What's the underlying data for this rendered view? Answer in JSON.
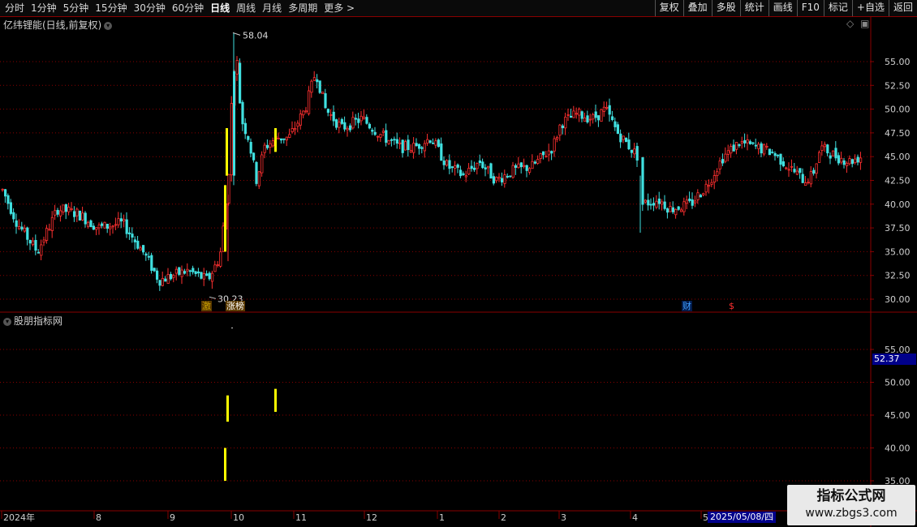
{
  "toolbar": {
    "periods": [
      "分时",
      "1分钟",
      "5分钟",
      "15分钟",
      "30分钟",
      "60分钟",
      "日线",
      "周线",
      "月线",
      "多周期",
      "更多 >"
    ],
    "active_period": "日线",
    "right_buttons": [
      "复权",
      "叠加",
      "多股",
      "统计",
      "画线",
      "F10",
      "标记",
      "+自选",
      "返回"
    ]
  },
  "main_panel": {
    "title": "亿纬锂能(日线,前复权)",
    "price_axis": [
      "55.00",
      "52.50",
      "50.00",
      "47.50",
      "45.00",
      "42.50",
      "40.00",
      "37.50",
      "35.00",
      "32.50",
      "30.00"
    ],
    "high_label": "58.04",
    "low_label": "30.23",
    "event_tags": [
      {
        "text": "激",
        "color": "#c8a000",
        "bg": "#5a3a00"
      },
      {
        "text": "涨榜",
        "color": "#ffffff",
        "bg": "#5a3a00"
      },
      {
        "text": "财",
        "color": "#40a0ff",
        "bg": "#001a4a"
      },
      {
        "text": "$",
        "color": "#ff3030",
        "bg": "#000000"
      }
    ]
  },
  "indicator_panel": {
    "title": "股朋指标网",
    "axis": [
      "55.00",
      "50.00",
      "45.00",
      "40.00",
      "35.00"
    ],
    "current_value": "52.37"
  },
  "time_axis": {
    "labels": [
      "2024年",
      "8",
      "9",
      "10",
      "11",
      "12",
      "1",
      "2",
      "3",
      "4",
      "5"
    ],
    "cursor_date": "2025/05/08/四"
  },
  "watermark": {
    "title": "指标公式网",
    "url": "www.zbgs3.com"
  },
  "colors": {
    "up": "#ff3030",
    "down": "#40e0e0",
    "signal": "#ffff00",
    "grid": "#8a0000",
    "axis_text": "#d0d0d0"
  }
}
